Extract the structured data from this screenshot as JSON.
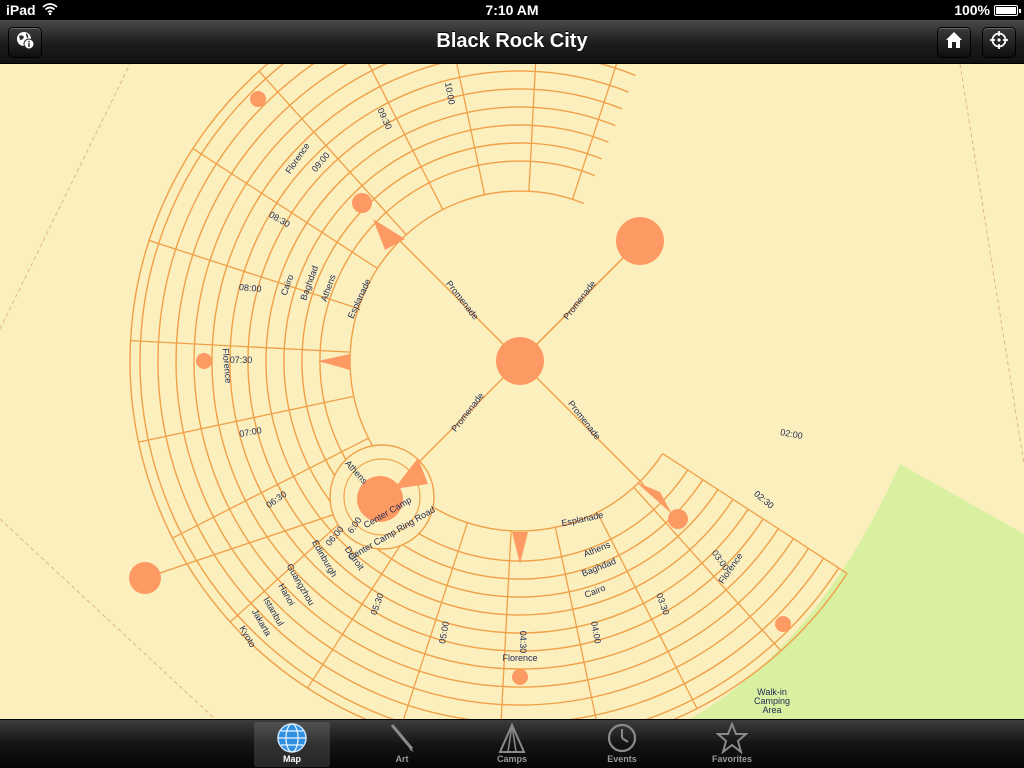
{
  "status_bar": {
    "device": "iPad",
    "time": "7:10 AM",
    "battery": "100%"
  },
  "nav": {
    "title": "Black Rock City",
    "left_button_icon": "info-globe-icon",
    "right_buttons": [
      "home-icon",
      "locate-icon"
    ]
  },
  "map": {
    "labels": {
      "promenade_nw": "Promenade",
      "promenade_ne": "Promenade",
      "promenade_sw": "Promenade",
      "promenade_se": "Promenade",
      "esplanade_w": "Esplanade",
      "esplanade_s": "Esplanade",
      "athens_w": "Athens",
      "baghdad_w": "Baghdad",
      "cairo_w": "Cairo",
      "florence_w": "Florence",
      "florence_nw": "Florence",
      "athens_s": "Athens",
      "baghdad_s": "Baghdad",
      "cairo_s": "Cairo",
      "florence_s": "Florence",
      "florence_se": "Florence",
      "center_camp": "Center Camp",
      "center_camp_ring": "Center Camp Ring Road",
      "athens_cc": "Athens",
      "t1000": "10:00",
      "t0930": "09:30",
      "t0900": "09:00",
      "t0830": "08:30",
      "t0800": "08:00",
      "t0730": "07:30",
      "t0700": "07:00",
      "t0630": "06:30",
      "t0600": "06:00",
      "t0600b": "6:00",
      "t0530": "05:30",
      "t0500": "05:00",
      "t0430": "04:30",
      "t0400": "04:00",
      "t0330": "03:30",
      "t0300": "03:00",
      "t0230": "02:30",
      "t0200": "02:00",
      "detroit": "Detroit",
      "edinburgh": "Edinburgh",
      "guangzhou": "Guangzhou",
      "hanoi": "Hanoi",
      "istanbul": "Istanbul",
      "jakarta": "Jakarta",
      "kyoto": "Kyoto",
      "walkin_1": "Walk-in",
      "walkin_2": "Camping",
      "walkin_3": "Area"
    },
    "colors": {
      "background": "#fbefbd",
      "street": "#f0a048",
      "plaza": "#fd9a64",
      "camping": "#d8f0a0",
      "label": "#1f2a55"
    }
  },
  "tabs": [
    {
      "label": "Map",
      "icon": "globe-icon",
      "selected": true
    },
    {
      "label": "Art",
      "icon": "brush-icon",
      "selected": false
    },
    {
      "label": "Camps",
      "icon": "tent-icon",
      "selected": false
    },
    {
      "label": "Events",
      "icon": "clock-icon",
      "selected": false
    },
    {
      "label": "Favorites",
      "icon": "star-icon",
      "selected": false
    }
  ]
}
